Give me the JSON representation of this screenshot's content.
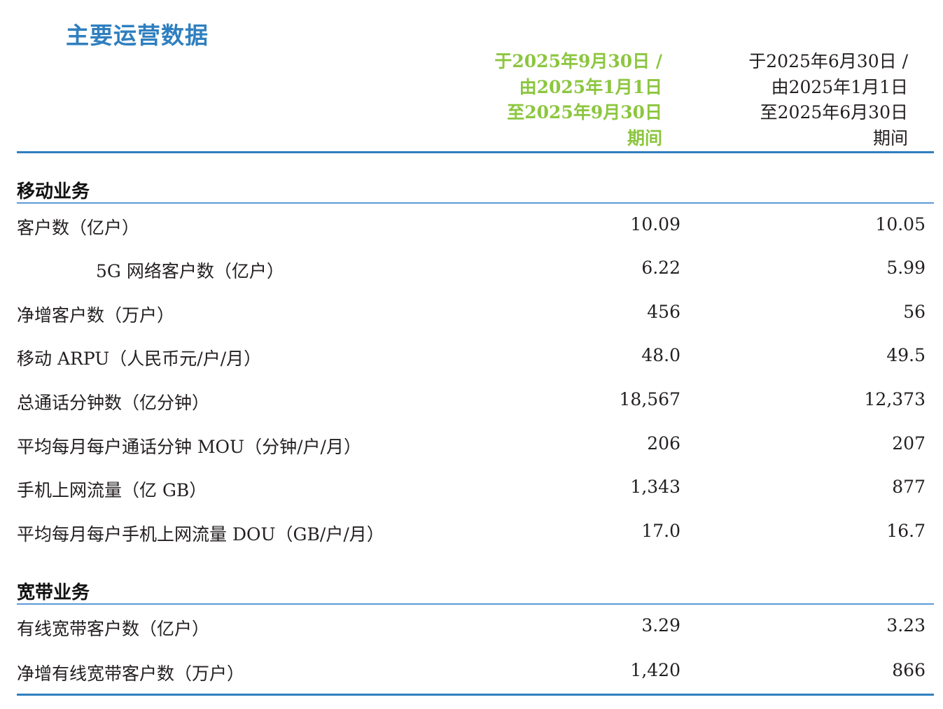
{
  "page": {
    "title": "主要运营数据"
  },
  "columns": {
    "current": [
      "于2025年9月30日 /",
      "由2025年1月1日",
      "至2025年9月30日",
      "期间"
    ],
    "prior": [
      "于2025年6月30日 /",
      "由2025年1月1日",
      "至2025年6月30日",
      "期间"
    ]
  },
  "colors": {
    "title": "#2f7fbf",
    "current_header": "#8cc63f",
    "rule": "#2f7fbf"
  },
  "sections": [
    {
      "title": "移动业务",
      "rows": [
        {
          "label": "客户数（亿户）",
          "current": "10.09",
          "prior": "10.05"
        },
        {
          "label": "5G 网络客户数（亿户）",
          "current": "6.22",
          "prior": "5.99"
        },
        {
          "label": "净增客户数（万户）",
          "current": "456",
          "prior": "56"
        },
        {
          "label": "移动 ARPU（人民币元/户/月）",
          "current": "48.0",
          "prior": "49.5"
        },
        {
          "label": "总通话分钟数（亿分钟）",
          "current": "18,567",
          "prior": "12,373"
        },
        {
          "label": "平均每月每户通话分钟 MOU（分钟/户/月）",
          "current": "206",
          "prior": "207"
        },
        {
          "label": "手机上网流量（亿 GB）",
          "current": "1,343",
          "prior": "877"
        },
        {
          "label": "平均每月每户手机上网流量 DOU（GB/户/月）",
          "current": "17.0",
          "prior": "16.7"
        }
      ]
    },
    {
      "title": "宽带业务",
      "rows": [
        {
          "label": "有线宽带客户数（亿户）",
          "current": "3.29",
          "prior": "3.23"
        },
        {
          "label": "净增有线宽带客户数（万户）",
          "current": "1,420",
          "prior": "866"
        }
      ]
    }
  ]
}
